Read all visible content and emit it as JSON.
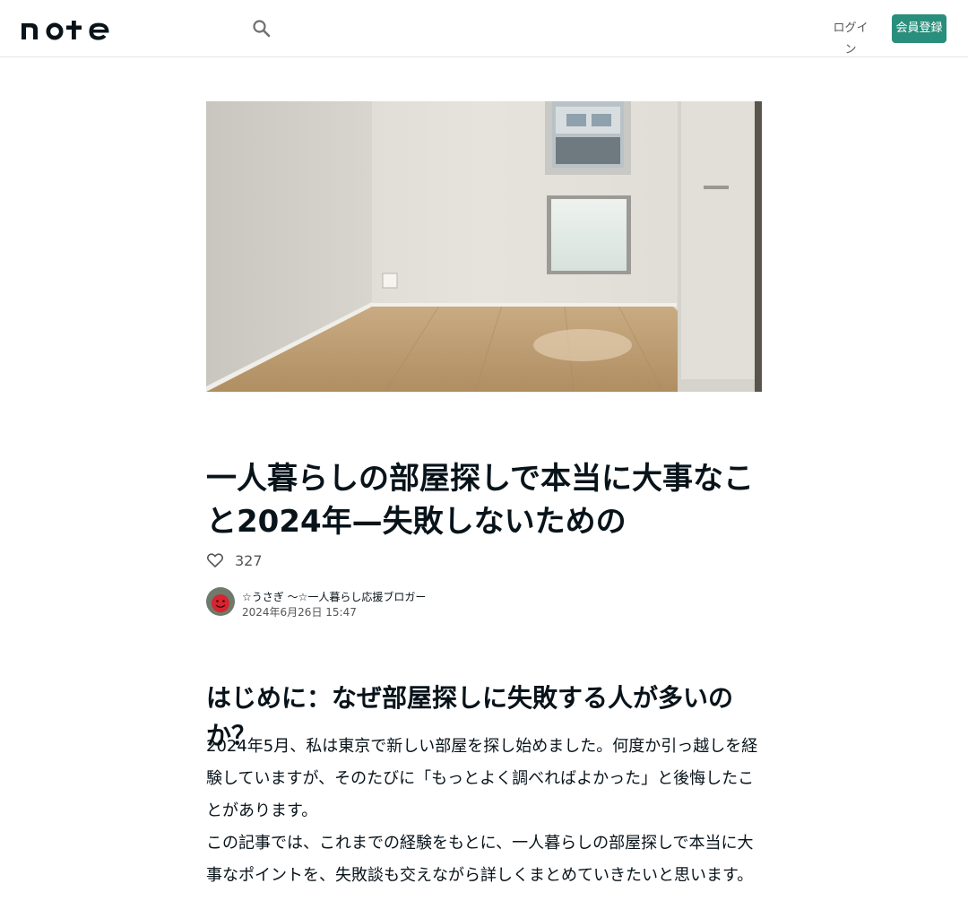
{
  "header": {
    "logo_text": "note",
    "search_icon": "search-icon",
    "login_label": "ログイン",
    "signup_label": "会員登録",
    "accent_color": "#2a8e7c"
  },
  "article": {
    "title": "一人暮らしの部屋探しで本当に大事なこと2024年—失敗しないための",
    "like_icon": "heart-icon",
    "like_count": "327",
    "author_name": "☆うさぎ 〜☆一人暮らし応援ブロガー",
    "date": "2024年6月26日 15:47",
    "section_heading": "はじめに：なぜ部屋探しに失敗する人が多いのか？",
    "paragraphs": [
      "2024年5月、私は東京で新しい部屋を探し始めました。何度か引っ越しを経験していますが、そのたびに「もっとよく調べればよかった」と後悔したことがあります。",
      "この記事では、これまでの経験をもとに、一人暮らしの部屋探しで本当に大事なポイントを、失敗談も交えながら詳しくまとめていきたいと思います。"
    ]
  }
}
